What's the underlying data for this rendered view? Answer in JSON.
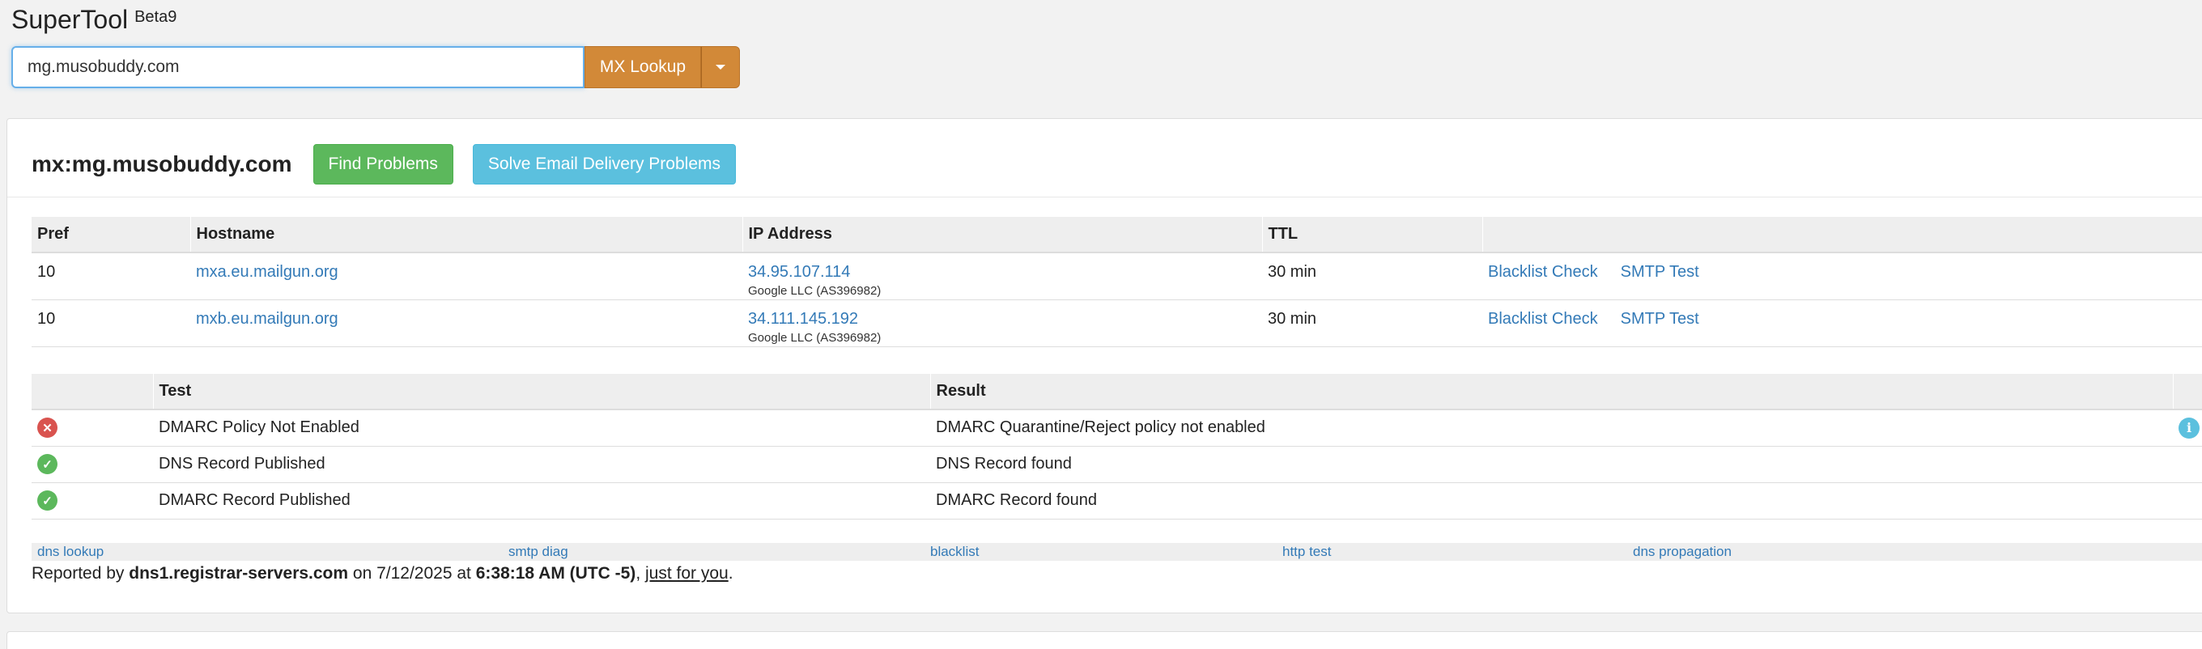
{
  "header": {
    "app_name": "SuperTool",
    "beta_label": "Beta9"
  },
  "search": {
    "value": "mg.musobuddy.com",
    "lookup_button": "MX Lookup"
  },
  "result": {
    "title": "mx:mg.musobuddy.com",
    "find_problems": "Find Problems",
    "solve_problems": "Solve Email Delivery Problems"
  },
  "mx_table": {
    "headers": [
      "Pref",
      "Hostname",
      "IP Address",
      "TTL",
      ""
    ],
    "rows": [
      {
        "pref": "10",
        "hostname": "mxa.eu.mailgun.org",
        "ip": "34.95.107.114",
        "org": "Google LLC (AS396982)",
        "ttl": "30 min",
        "blacklist": "Blacklist Check",
        "smtp": "SMTP Test"
      },
      {
        "pref": "10",
        "hostname": "mxb.eu.mailgun.org",
        "ip": "34.111.145.192",
        "org": "Google LLC (AS396982)",
        "ttl": "30 min",
        "blacklist": "Blacklist Check",
        "smtp": "SMTP Test"
      }
    ]
  },
  "test_table": {
    "headers": [
      "",
      "Test",
      "Result",
      ""
    ],
    "rows": [
      {
        "status": "error",
        "status_icon": "x-circle-icon",
        "test": "DMARC Policy Not Enabled",
        "result": "DMARC Quarantine/Reject policy not enabled",
        "info": "i"
      },
      {
        "status": "ok",
        "status_icon": "check-circle-icon",
        "test": "DNS Record Published",
        "result": "DNS Record found"
      },
      {
        "status": "ok",
        "status_icon": "check-circle-icon",
        "test": "DMARC Record Published",
        "result": "DMARC Record found"
      }
    ]
  },
  "footer": {
    "links": [
      "dns lookup",
      "smtp diag",
      "blacklist",
      "http test",
      "dns propagation"
    ],
    "reported_prefix": "Reported by",
    "server": "dns1.registrar-servers.com",
    "on": "on 7/12/2025 at",
    "time": "6:38:18 AM (UTC -5)",
    "just_for_you": "just for you",
    "period": "."
  },
  "colors": {
    "accent_orange": "#d28938",
    "success": "#5cb85c",
    "info": "#5bc0de",
    "danger": "#d9534f",
    "link": "#337ab7"
  }
}
